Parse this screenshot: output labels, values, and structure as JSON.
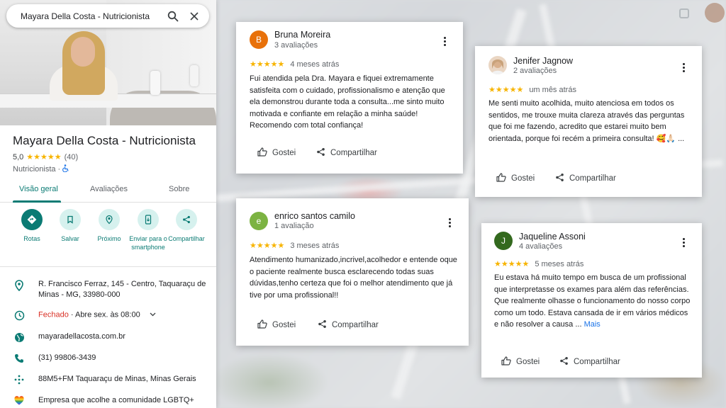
{
  "search": {
    "query": "Mayara Della Costa - Nutricionista"
  },
  "place": {
    "title": "Mayara Della Costa - Nutricionista",
    "rating": "5,0",
    "stars": "★★★★★",
    "review_count": "(40)",
    "category": "Nutricionista",
    "category_sep": "·"
  },
  "tabs": {
    "overview": "Visão geral",
    "reviews": "Avaliações",
    "about": "Sobre"
  },
  "actions": {
    "routes": "Rotas",
    "save": "Salvar",
    "nearby": "Próximo",
    "send_to_phone": "Enviar para o smartphone",
    "share": "Compartilhar"
  },
  "info": {
    "address": "R. Francisco Ferraz, 145 - Centro, Taquaraçu de Minas - MG, 33980-000",
    "hours_status": "Fechado",
    "hours_detail": " · Abre sex. às 08:00",
    "website": "mayaradellacosta.com.br",
    "phone": "(31) 99806-3439",
    "plus_code": "88M5+FM Taquaraçu de Minas, Minas Gerais",
    "lgbtq": "Empresa que acolhe a comunidade LGBTQ+"
  },
  "reviews": [
    {
      "initial": "B",
      "avatar_color": "#e8710a",
      "name": "Bruna Moreira",
      "count": "3 avaliações",
      "stars": "★★★★★",
      "when": "4 meses atrás",
      "text": "Fui atendida pela Dra. Mayara e fiquei extremamente satisfeita com o cuidado, profissionalismo e atenção que ela demonstrou durante toda a consulta...me sinto muito motivada e confiante em relação a minha saúde! Recomendo com total confiança!",
      "more": "",
      "like": "Gostei",
      "share": "Compartilhar"
    },
    {
      "initial": "",
      "avatar_color": "#e9c9a8",
      "name": "Jenifer Jagnow",
      "count": "2 avaliações",
      "stars": "★★★★★",
      "when": "um mês atrás",
      "text": "Me senti muito acolhida, muito atenciosa em todos os sentidos, me trouxe muita clareza através das perguntas que foi me fazendo, acredito que estarei muito bem orientada, porque foi recém a primeira consulta! 🥰🙏🏻 ...",
      "more": "",
      "like": "Gostei",
      "share": "Compartilhar"
    },
    {
      "initial": "e",
      "avatar_color": "#7cb342",
      "name": "enrico santos camilo",
      "count": "1 avaliação",
      "stars": "★★★★★",
      "when": "3 meses atrás",
      "text": "Atendimento humanizado,incrivel,acolhedor e entende oque o paciente realmente busca esclarecendo todas suas dúvidas,tenho certeza que foi o melhor atendimento que já tive por uma profissional!!",
      "more": "",
      "like": "Gostei",
      "share": "Compartilhar"
    },
    {
      "initial": "J",
      "avatar_color": "#33691e",
      "name": "Jaqueline Assoni",
      "count": "4 avaliações",
      "stars": "★★★★★",
      "when": "5 meses atrás",
      "text": "Eu estava há muito tempo em busca de um profissional que interpretasse os exames para além das referências. Que realmente olhasse o funcionamento do nosso corpo como um todo. Estava cansada de ir em vários médicos e não resolver a causa ...",
      "more": " Mais",
      "like": "Gostei",
      "share": "Compartilhar"
    }
  ],
  "colors": {
    "accent": "#0b7b74",
    "star": "#f7b400",
    "closed": "#d93025"
  }
}
